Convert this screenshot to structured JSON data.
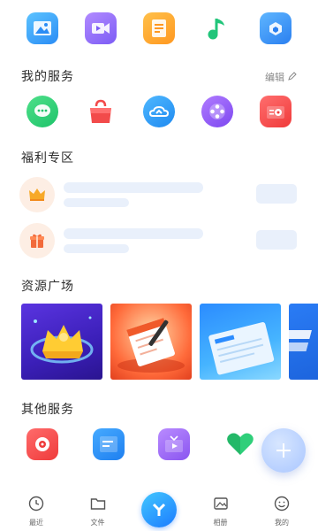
{
  "sections": {
    "my_services": "我的服务",
    "welfare": "福利专区",
    "resources": "资源广场",
    "other_services": "其他服务"
  },
  "edit_label": "编辑",
  "top_icons": [
    "image-icon",
    "video-icon",
    "document-icon",
    "music-icon",
    "app-icon"
  ],
  "my_services_icons": [
    "chat-icon",
    "shopping-bag-icon",
    "cloud-icon",
    "film-reel-icon",
    "radio-icon"
  ],
  "other_services_icons": [
    "music-disc-icon",
    "notes-icon",
    "tv-icon",
    "heart-icon",
    "add-icon"
  ],
  "resource_cards": [
    "reward-card",
    "notepad-card",
    "document-card",
    "banner-card"
  ],
  "bottom_nav": {
    "recent": "最近",
    "files": "文件",
    "album": "相册",
    "mine": "我的"
  },
  "colors": {
    "skeleton": "#e9f0fb",
    "accent": "#1b7bff"
  }
}
